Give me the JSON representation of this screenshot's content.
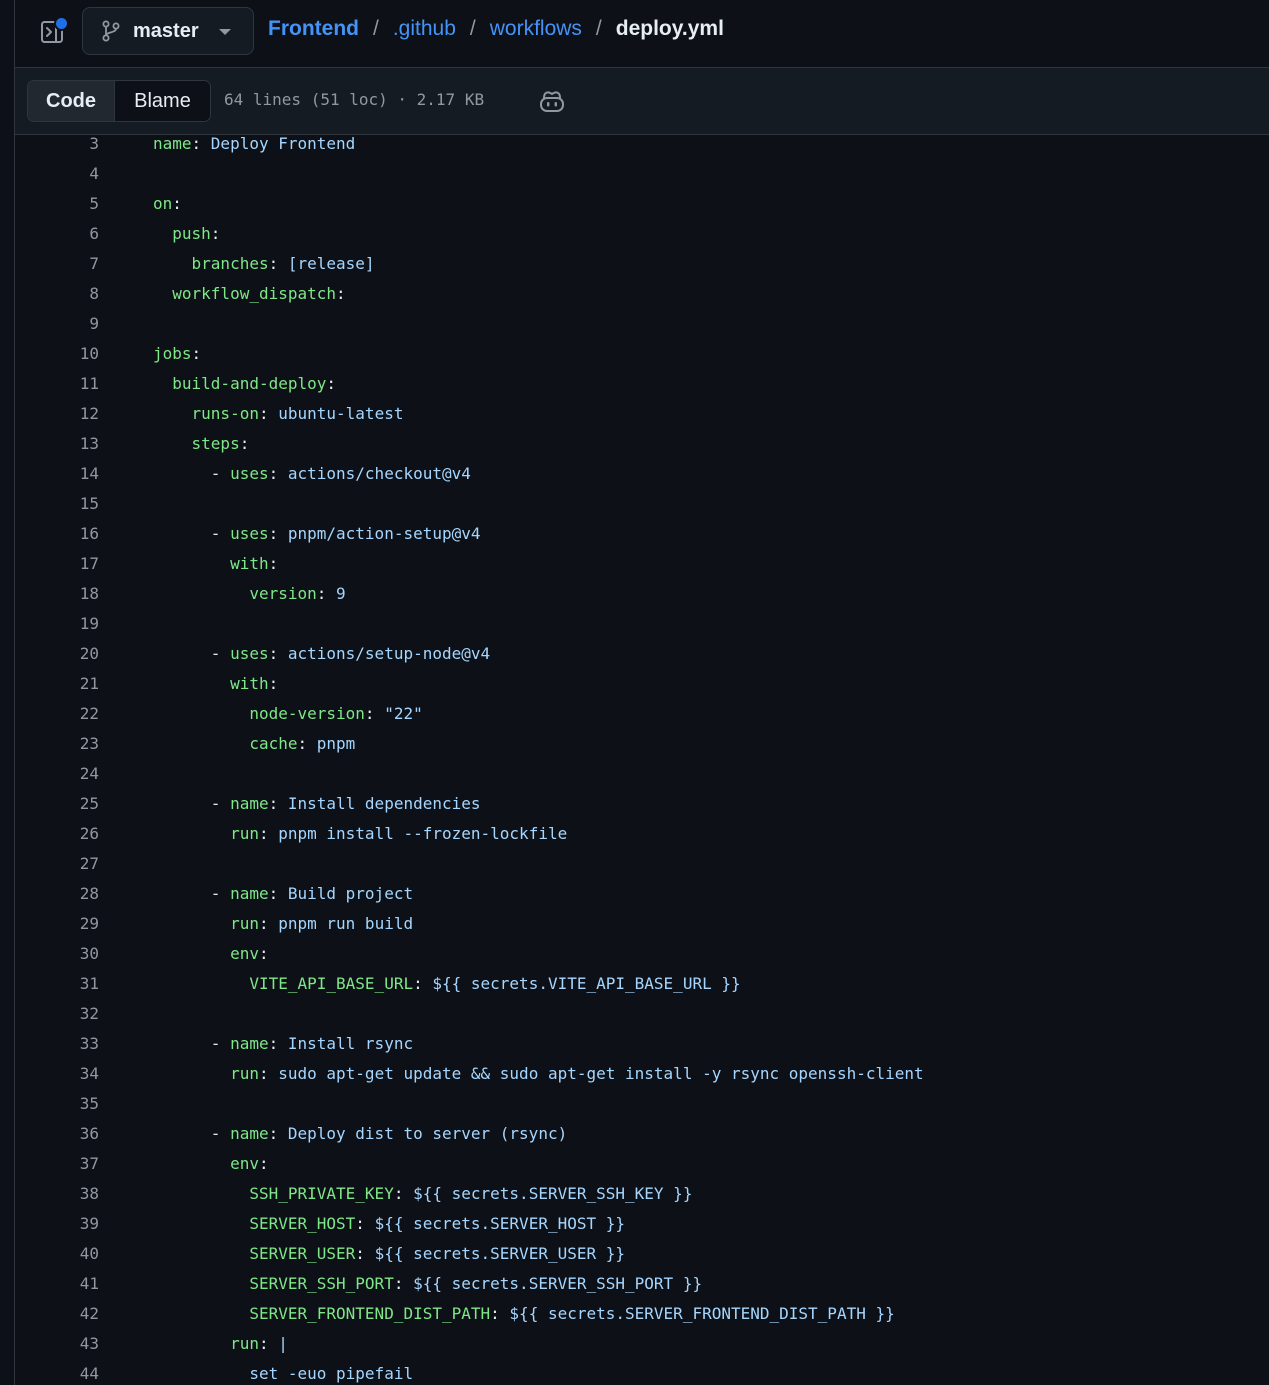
{
  "header": {
    "branch": "master",
    "breadcrumb": {
      "repo": "Frontend",
      "folder1": ".github",
      "folder2": "workflows",
      "file": "deploy.yml",
      "separator": "/"
    }
  },
  "toolbar": {
    "code_tab": "Code",
    "blame_tab": "Blame",
    "file_info": "64 lines (51 loc) · 2.17 KB"
  },
  "colors": {
    "key": "#7ee787",
    "value": "#a5d6ff",
    "link": "#4493f8",
    "background": "#0d1117"
  },
  "icons": {
    "sidebar": "sidebar-expand-icon",
    "branch": "git-branch-icon",
    "copilot": "copilot-icon"
  },
  "code": {
    "lines": [
      {
        "n": "3",
        "indent": "",
        "dash": "",
        "key": "name",
        "sep": ": ",
        "value": "Deploy Frontend"
      },
      {
        "n": "4",
        "indent": "",
        "dash": "",
        "key": "",
        "sep": "",
        "value": ""
      },
      {
        "n": "5",
        "indent": "",
        "dash": "",
        "key": "on",
        "sep": ":",
        "value": ""
      },
      {
        "n": "6",
        "indent": "  ",
        "dash": "",
        "key": "push",
        "sep": ":",
        "value": ""
      },
      {
        "n": "7",
        "indent": "    ",
        "dash": "",
        "key": "branches",
        "sep": ": ",
        "value": "[release]"
      },
      {
        "n": "8",
        "indent": "  ",
        "dash": "",
        "key": "workflow_dispatch",
        "sep": ":",
        "value": ""
      },
      {
        "n": "9",
        "indent": "",
        "dash": "",
        "key": "",
        "sep": "",
        "value": ""
      },
      {
        "n": "10",
        "indent": "",
        "dash": "",
        "key": "jobs",
        "sep": ":",
        "value": ""
      },
      {
        "n": "11",
        "indent": "  ",
        "dash": "",
        "key": "build-and-deploy",
        "sep": ":",
        "value": ""
      },
      {
        "n": "12",
        "indent": "    ",
        "dash": "",
        "key": "runs-on",
        "sep": ": ",
        "value": "ubuntu-latest"
      },
      {
        "n": "13",
        "indent": "    ",
        "dash": "",
        "key": "steps",
        "sep": ":",
        "value": ""
      },
      {
        "n": "14",
        "indent": "      ",
        "dash": "- ",
        "key": "uses",
        "sep": ": ",
        "value": "actions/checkout@v4"
      },
      {
        "n": "15",
        "indent": "",
        "dash": "",
        "key": "",
        "sep": "",
        "value": ""
      },
      {
        "n": "16",
        "indent": "      ",
        "dash": "- ",
        "key": "uses",
        "sep": ": ",
        "value": "pnpm/action-setup@v4"
      },
      {
        "n": "17",
        "indent": "        ",
        "dash": "",
        "key": "with",
        "sep": ":",
        "value": ""
      },
      {
        "n": "18",
        "indent": "          ",
        "dash": "",
        "key": "version",
        "sep": ": ",
        "value": "9"
      },
      {
        "n": "19",
        "indent": "",
        "dash": "",
        "key": "",
        "sep": "",
        "value": ""
      },
      {
        "n": "20",
        "indent": "      ",
        "dash": "- ",
        "key": "uses",
        "sep": ": ",
        "value": "actions/setup-node@v4"
      },
      {
        "n": "21",
        "indent": "        ",
        "dash": "",
        "key": "with",
        "sep": ":",
        "value": ""
      },
      {
        "n": "22",
        "indent": "          ",
        "dash": "",
        "key": "node-version",
        "sep": ": ",
        "value": "\"22\""
      },
      {
        "n": "23",
        "indent": "          ",
        "dash": "",
        "key": "cache",
        "sep": ": ",
        "value": "pnpm"
      },
      {
        "n": "24",
        "indent": "",
        "dash": "",
        "key": "",
        "sep": "",
        "value": ""
      },
      {
        "n": "25",
        "indent": "      ",
        "dash": "- ",
        "key": "name",
        "sep": ": ",
        "value": "Install dependencies"
      },
      {
        "n": "26",
        "indent": "        ",
        "dash": "",
        "key": "run",
        "sep": ": ",
        "value": "pnpm install --frozen-lockfile"
      },
      {
        "n": "27",
        "indent": "",
        "dash": "",
        "key": "",
        "sep": "",
        "value": ""
      },
      {
        "n": "28",
        "indent": "      ",
        "dash": "- ",
        "key": "name",
        "sep": ": ",
        "value": "Build project"
      },
      {
        "n": "29",
        "indent": "        ",
        "dash": "",
        "key": "run",
        "sep": ": ",
        "value": "pnpm run build"
      },
      {
        "n": "30",
        "indent": "        ",
        "dash": "",
        "key": "env",
        "sep": ":",
        "value": ""
      },
      {
        "n": "31",
        "indent": "          ",
        "dash": "",
        "key": "VITE_API_BASE_URL",
        "sep": ": ",
        "value": "${{ secrets.VITE_API_BASE_URL }}"
      },
      {
        "n": "32",
        "indent": "",
        "dash": "",
        "key": "",
        "sep": "",
        "value": ""
      },
      {
        "n": "33",
        "indent": "      ",
        "dash": "- ",
        "key": "name",
        "sep": ": ",
        "value": "Install rsync"
      },
      {
        "n": "34",
        "indent": "        ",
        "dash": "",
        "key": "run",
        "sep": ": ",
        "value": "sudo apt-get update && sudo apt-get install -y rsync openssh-client"
      },
      {
        "n": "35",
        "indent": "",
        "dash": "",
        "key": "",
        "sep": "",
        "value": ""
      },
      {
        "n": "36",
        "indent": "      ",
        "dash": "- ",
        "key": "name",
        "sep": ": ",
        "value": "Deploy dist to server (rsync)"
      },
      {
        "n": "37",
        "indent": "        ",
        "dash": "",
        "key": "env",
        "sep": ":",
        "value": ""
      },
      {
        "n": "38",
        "indent": "          ",
        "dash": "",
        "key": "SSH_PRIVATE_KEY",
        "sep": ": ",
        "value": "${{ secrets.SERVER_SSH_KEY }}"
      },
      {
        "n": "39",
        "indent": "          ",
        "dash": "",
        "key": "SERVER_HOST",
        "sep": ": ",
        "value": "${{ secrets.SERVER_HOST }}"
      },
      {
        "n": "40",
        "indent": "          ",
        "dash": "",
        "key": "SERVER_USER",
        "sep": ": ",
        "value": "${{ secrets.SERVER_USER }}"
      },
      {
        "n": "41",
        "indent": "          ",
        "dash": "",
        "key": "SERVER_SSH_PORT",
        "sep": ": ",
        "value": "${{ secrets.SERVER_SSH_PORT }}"
      },
      {
        "n": "42",
        "indent": "          ",
        "dash": "",
        "key": "SERVER_FRONTEND_DIST_PATH",
        "sep": ": ",
        "value": "${{ secrets.SERVER_FRONTEND_DIST_PATH }}"
      },
      {
        "n": "43",
        "indent": "        ",
        "dash": "",
        "key": "run",
        "sep": ": ",
        "value": "|"
      },
      {
        "n": "44",
        "indent": "          ",
        "dash": "",
        "key": "",
        "sep": "",
        "value": "set -euo pipefail"
      }
    ]
  }
}
